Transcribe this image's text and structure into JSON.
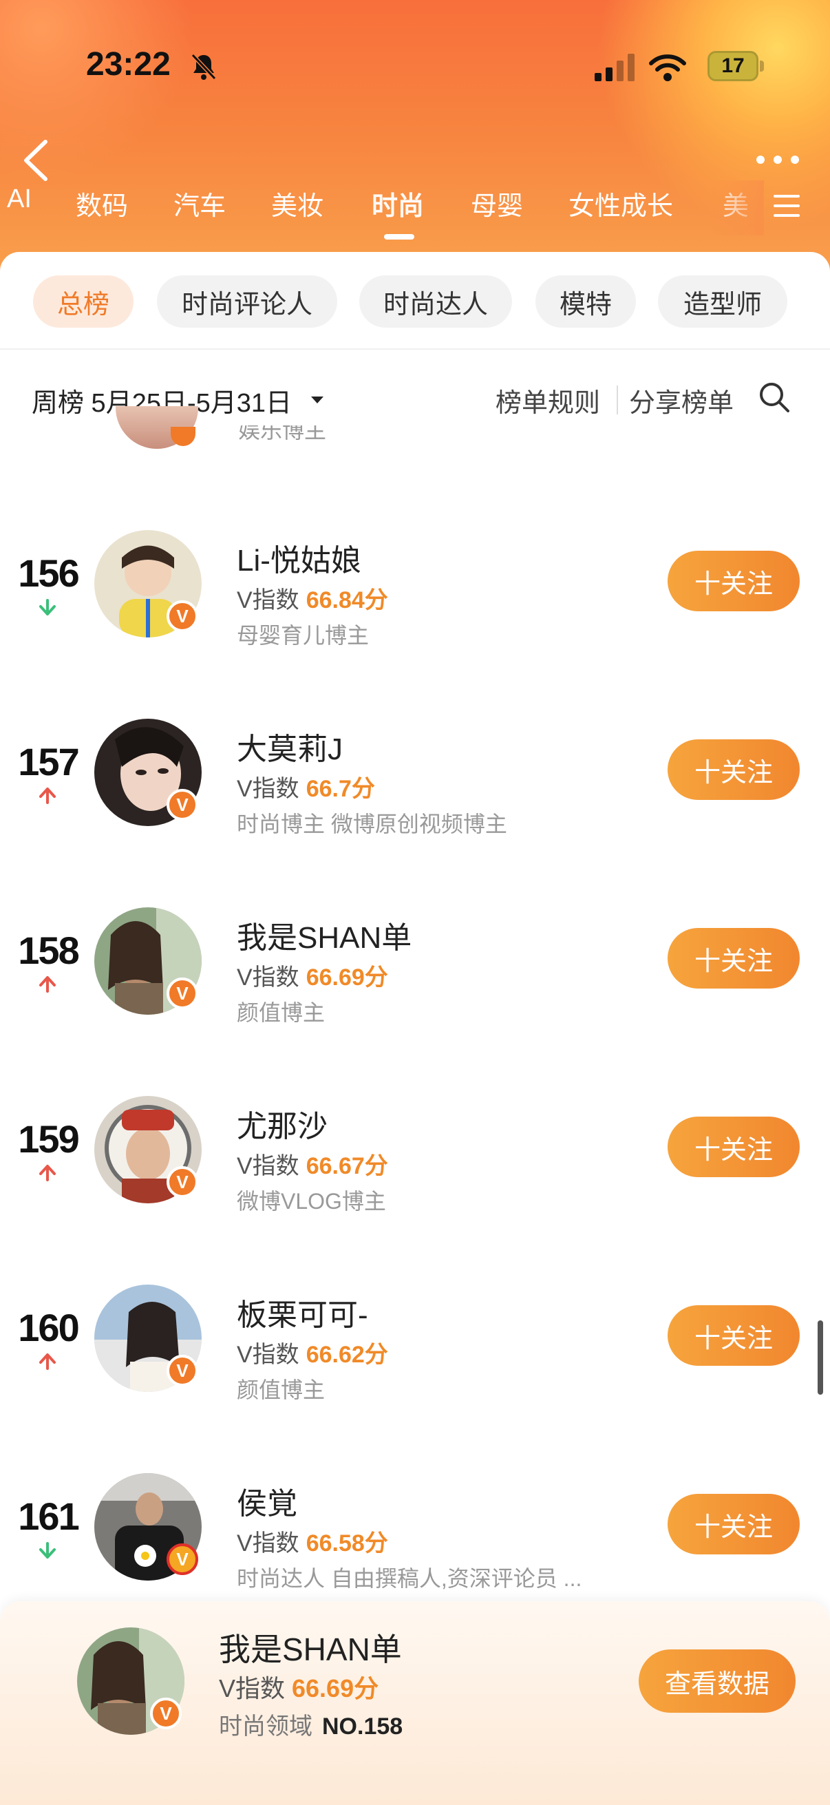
{
  "status_bar": {
    "time": "23:22",
    "battery": "17",
    "icons": [
      "bell-slash-icon",
      "cellular-signal-icon",
      "wifi-icon",
      "battery-icon"
    ]
  },
  "nav": {
    "back_icon": "chevron-left-icon",
    "more_icon": "ellipsis-icon",
    "menu_icon": "hamburger-menu-icon",
    "categories": [
      {
        "label": "AI",
        "active": false
      },
      {
        "label": "数码",
        "active": false
      },
      {
        "label": "汽车",
        "active": false
      },
      {
        "label": "美妆",
        "active": false
      },
      {
        "label": "时尚",
        "active": true
      },
      {
        "label": "母婴",
        "active": false
      },
      {
        "label": "女性成长",
        "active": false
      },
      {
        "label": "美",
        "active": false
      }
    ]
  },
  "sub_tabs": [
    {
      "label": "总榜",
      "active": true
    },
    {
      "label": "时尚评论人",
      "active": false
    },
    {
      "label": "时尚达人",
      "active": false
    },
    {
      "label": "模特",
      "active": false
    },
    {
      "label": "造型师",
      "active": false
    }
  ],
  "filter": {
    "period": "周榜 5月25日-5月31日",
    "rules_label": "榜单规则",
    "share_label": "分享榜单"
  },
  "peek_row": {
    "tag": "娱乐博主"
  },
  "ranking": [
    {
      "rank": "156",
      "trend": "down",
      "name": "Li-悦姑娘",
      "vindex_label": "V指数",
      "score": "66.84分",
      "tags": "母婴育儿博主",
      "follow_label": "十关注",
      "avatar_color": "#d9c59a"
    },
    {
      "rank": "157",
      "trend": "up",
      "name": "大莫莉J",
      "vindex_label": "V指数",
      "score": "66.7分",
      "tags": "时尚博主 微博原创视频博主",
      "follow_label": "十关注",
      "avatar_color": "#3a2e2a"
    },
    {
      "rank": "158",
      "trend": "up",
      "name": "我是SHAN单",
      "vindex_label": "V指数",
      "score": "66.69分",
      "tags": "颜值博主",
      "follow_label": "十关注",
      "avatar_color": "#6b5a45"
    },
    {
      "rank": "159",
      "trend": "up",
      "name": "尤那沙",
      "vindex_label": "V指数",
      "score": "66.67分",
      "tags": "微博VLOG博主",
      "follow_label": "十关注",
      "avatar_color": "#b04a3a"
    },
    {
      "rank": "160",
      "trend": "up",
      "name": "板栗可可-",
      "vindex_label": "V指数",
      "score": "66.62分",
      "tags": "颜值博主",
      "follow_label": "十关注",
      "avatar_color": "#8aa7c2"
    },
    {
      "rank": "161",
      "trend": "down",
      "name": "侯覚",
      "vindex_label": "V指数",
      "score": "66.58分",
      "tags": "时尚达人 自由撰稿人,资深评论员 ...",
      "follow_label": "十关注",
      "avatar_color": "#2c2f36"
    }
  ],
  "me": {
    "name": "我是SHAN单",
    "vindex_label": "V指数",
    "score": "66.69分",
    "domain_label": "时尚领域",
    "rank_no": "NO.158",
    "view_data_label": "查看数据"
  },
  "colors": {
    "accent": "#f08a28",
    "trend_up": "#e8574a",
    "trend_down": "#3bbf7a"
  }
}
